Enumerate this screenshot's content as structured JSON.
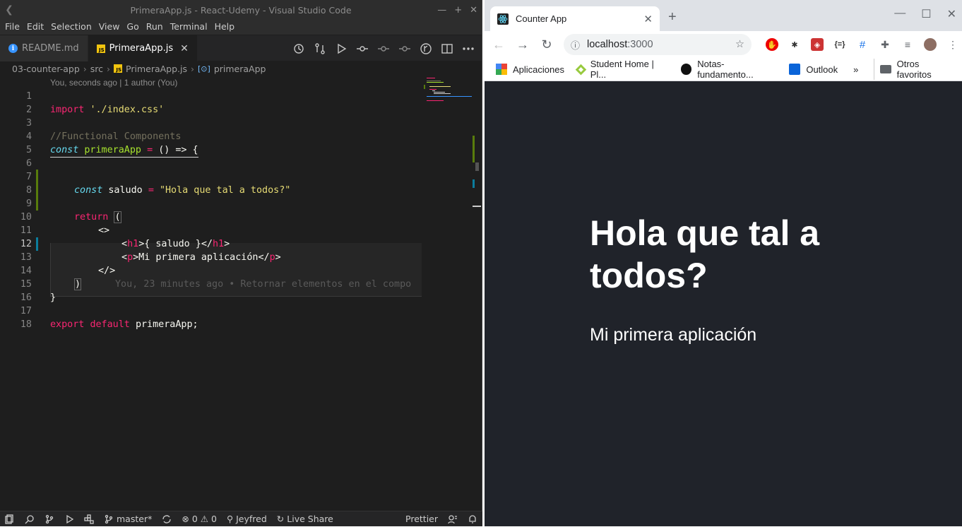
{
  "vscode": {
    "window_title": "PrimeraApp.js - React-Udemy - Visual Studio Code",
    "menu": [
      "File",
      "Edit",
      "Selection",
      "View",
      "Go",
      "Run",
      "Terminal",
      "Help"
    ],
    "tabs": [
      {
        "label": "README.md",
        "icon": "info-icon",
        "active": false
      },
      {
        "label": "PrimeraApp.js",
        "icon": "js-file-icon",
        "active": true
      }
    ],
    "breadcrumbs": [
      "03-counter-app",
      "src",
      "PrimeraApp.js",
      "primeraApp"
    ],
    "codelens": "You, seconds ago | 1 author (You)",
    "line_numbers": [
      "1",
      "2",
      "3",
      "4",
      "5",
      "6",
      "7",
      "8",
      "9",
      "10",
      "11",
      "12",
      "13",
      "14",
      "15",
      "16",
      "17",
      "18"
    ],
    "code": {
      "l2": {
        "kw": "import",
        "str": "'./index.css'"
      },
      "l4": {
        "comment": "//Functional Components"
      },
      "l5": {
        "kw": "const",
        "name": "primeraApp",
        "op": "=",
        "rest": "() => {"
      },
      "l8": {
        "kw": "const",
        "name": "saludo",
        "op": "=",
        "str": "\"Hola que tal a todos?\""
      },
      "l10": {
        "kw": "return",
        "paren": "("
      },
      "l11": {
        "text": "<>"
      },
      "l12": {
        "open": "<",
        "tag": "h1",
        "mid": ">{ saludo }</",
        "tag2": "h1",
        "close": ">"
      },
      "l13": {
        "open": "<",
        "tag": "p",
        "mid": ">Mi primera aplicación</",
        "tag2": "p",
        "close": ">"
      },
      "l14": {
        "text": "</>"
      },
      "l15": {
        "paren": ")",
        "blame": "You, 23 minutes ago • Retornar elementos en el compo"
      },
      "l16": {
        "text": "}"
      },
      "l18": {
        "kw1": "export",
        "kw2": "default",
        "name": "primeraApp;"
      }
    },
    "status": {
      "branch": "master*",
      "errors": "0",
      "warnings": "0",
      "user": "Jeyfred",
      "live_share": "Live Share",
      "formatter": "Prettier"
    }
  },
  "chrome": {
    "tab_title": "Counter App",
    "url_host": "localhost",
    "url_port": ":3000",
    "bookmarks": [
      "Aplicaciones",
      "Student Home | Pl...",
      "Notas-fundamento...",
      "Outlook"
    ],
    "other_bookmarks": "Otros favoritos",
    "page": {
      "heading": "Hola que tal a todos?",
      "paragraph": "Mi primera aplicación"
    }
  }
}
